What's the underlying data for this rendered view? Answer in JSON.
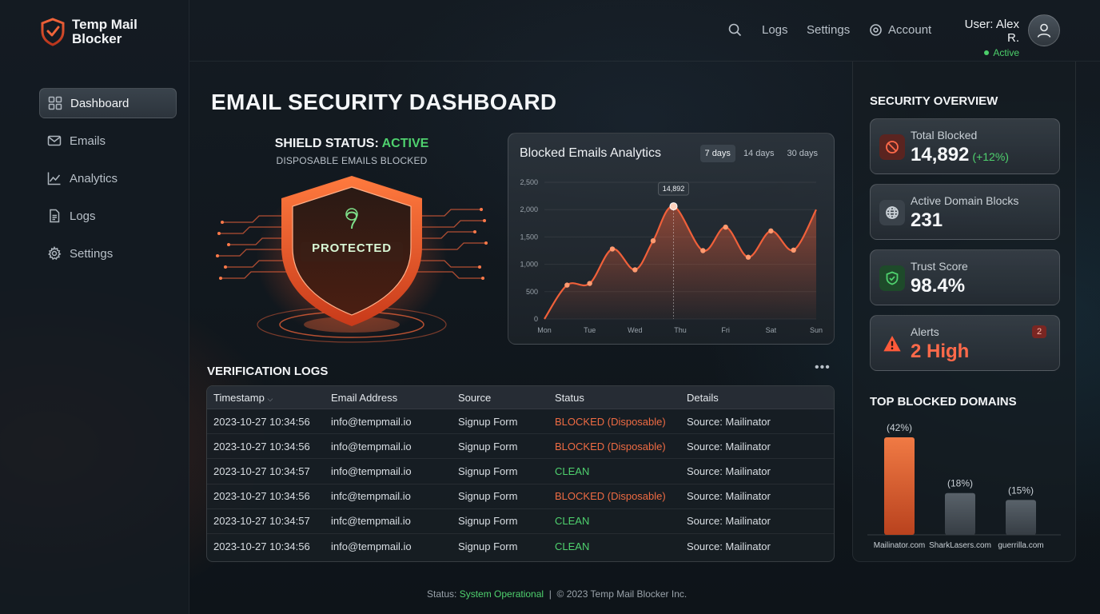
{
  "app": {
    "name": "Temp Mail Blocker"
  },
  "sidebar": {
    "items": [
      {
        "label": "Dashboard",
        "icon": "dashboard-icon",
        "active": true
      },
      {
        "label": "Emails",
        "icon": "mail-icon"
      },
      {
        "label": "Analytics",
        "icon": "analytics-icon"
      },
      {
        "label": "Logs",
        "icon": "document-icon"
      },
      {
        "label": "Settings",
        "icon": "gear-icon"
      }
    ]
  },
  "header": {
    "logs": "Logs",
    "settings": "Settings",
    "account": "Account",
    "user": "User: Alex R.",
    "user_status": "Active"
  },
  "main": {
    "title": "EMAIL SECURITY DASHBOARD",
    "shield": {
      "status_prefix": "SHIELD STATUS: ",
      "status_value": "ACTIVE",
      "subtitle": "DISPOSABLE EMAILS BLOCKED",
      "label": "PROTECTED"
    }
  },
  "chart": {
    "title": "Blocked Emails Analytics",
    "ranges": [
      "7 days",
      "14 days",
      "30 days"
    ],
    "selected_range": "7 days"
  },
  "chart_data": {
    "type": "area",
    "title": "Blocked Emails Analytics",
    "x": [
      "Mon",
      "Tue",
      "Wed",
      "Thu",
      "Fri",
      "Sat",
      "Sun"
    ],
    "y_ticks": [
      0,
      500,
      "1,000",
      "1,500",
      "2,000",
      "2,500"
    ],
    "ylim": [
      0,
      2500
    ],
    "points": [
      {
        "x": 0.0,
        "y": 0
      },
      {
        "x": 0.5,
        "y": 620
      },
      {
        "x": 1.0,
        "y": 650
      },
      {
        "x": 1.5,
        "y": 1280
      },
      {
        "x": 2.0,
        "y": 900
      },
      {
        "x": 2.4,
        "y": 1430
      },
      {
        "x": 2.85,
        "y": 2060
      },
      {
        "x": 3.5,
        "y": 1250
      },
      {
        "x": 4.0,
        "y": 1680
      },
      {
        "x": 4.5,
        "y": 1130
      },
      {
        "x": 5.0,
        "y": 1610
      },
      {
        "x": 5.5,
        "y": 1260
      },
      {
        "x": 6.0,
        "y": 2000
      }
    ],
    "highlight": {
      "x": 2.85,
      "y": 2060,
      "label": "14,892"
    },
    "color": "#f0603a"
  },
  "logs": {
    "title": "VERIFICATION LOGS",
    "columns": [
      "Timestamp",
      "Email Address",
      "Source",
      "Status",
      "Details"
    ],
    "rows": [
      {
        "timestamp": "2023-10-27 10:34:56",
        "email": "info@tempmail.io",
        "source": "Signup Form",
        "status": "BLOCKED (Disposable)",
        "type": "blocked",
        "details": "Source: Mailinator"
      },
      {
        "timestamp": "2023-10-27 10:34:56",
        "email": "info@tempmail.io",
        "source": "Signup Form",
        "status": "BLOCKED (Disposable)",
        "type": "blocked",
        "details": "Source: Mailinator"
      },
      {
        "timestamp": "2023-10-27 10:34:57",
        "email": "info@tempmail.io",
        "source": "Signup Form",
        "status": "CLEAN",
        "type": "clean",
        "details": "Source: Mailinator"
      },
      {
        "timestamp": "2023-10-27 10:34:56",
        "email": "infc@tempmail.io",
        "source": "Signup Form",
        "status": "BLOCKED (Disposable)",
        "type": "blocked",
        "details": "Source: Mailinator"
      },
      {
        "timestamp": "2023-10-27 10:34:57",
        "email": "infc@tempmail.io",
        "source": "Signup Form",
        "status": "CLEAN",
        "type": "clean",
        "details": "Source: Mailinator"
      },
      {
        "timestamp": "2023-10-27 10:34:56",
        "email": "info@tempmail.io",
        "source": "Signup Form",
        "status": "CLEAN",
        "type": "clean",
        "details": "Source: Mailinator"
      }
    ]
  },
  "overview": {
    "title": "SECURITY OVERVIEW",
    "total_blocked": {
      "label": "Total Blocked",
      "value": "14,892",
      "delta": "(+12%)"
    },
    "domain_blocks": {
      "label": "Active Domain Blocks",
      "value": "231"
    },
    "trust": {
      "label": "Trust Score",
      "value": "98.4%"
    },
    "alerts": {
      "label": "Alerts",
      "value": "2 High",
      "badge": "2"
    }
  },
  "top_domains": {
    "title": "TOP BLOCKED DOMAINS",
    "chart_data": {
      "type": "bar",
      "categories": [
        "Mailinator.com",
        "SharkLasers.com",
        "guerrilla.com"
      ],
      "values": [
        42,
        18,
        15
      ],
      "labels": [
        "(42%)",
        "(18%)",
        "(15%)"
      ],
      "colors": [
        "#e8693a",
        "#4a5259",
        "#4a5259"
      ]
    }
  },
  "footer": {
    "status_prefix": "Status: ",
    "status_value": "System Operational",
    "copyright": "  |  © 2023 Temp Mail Blocker Inc."
  }
}
